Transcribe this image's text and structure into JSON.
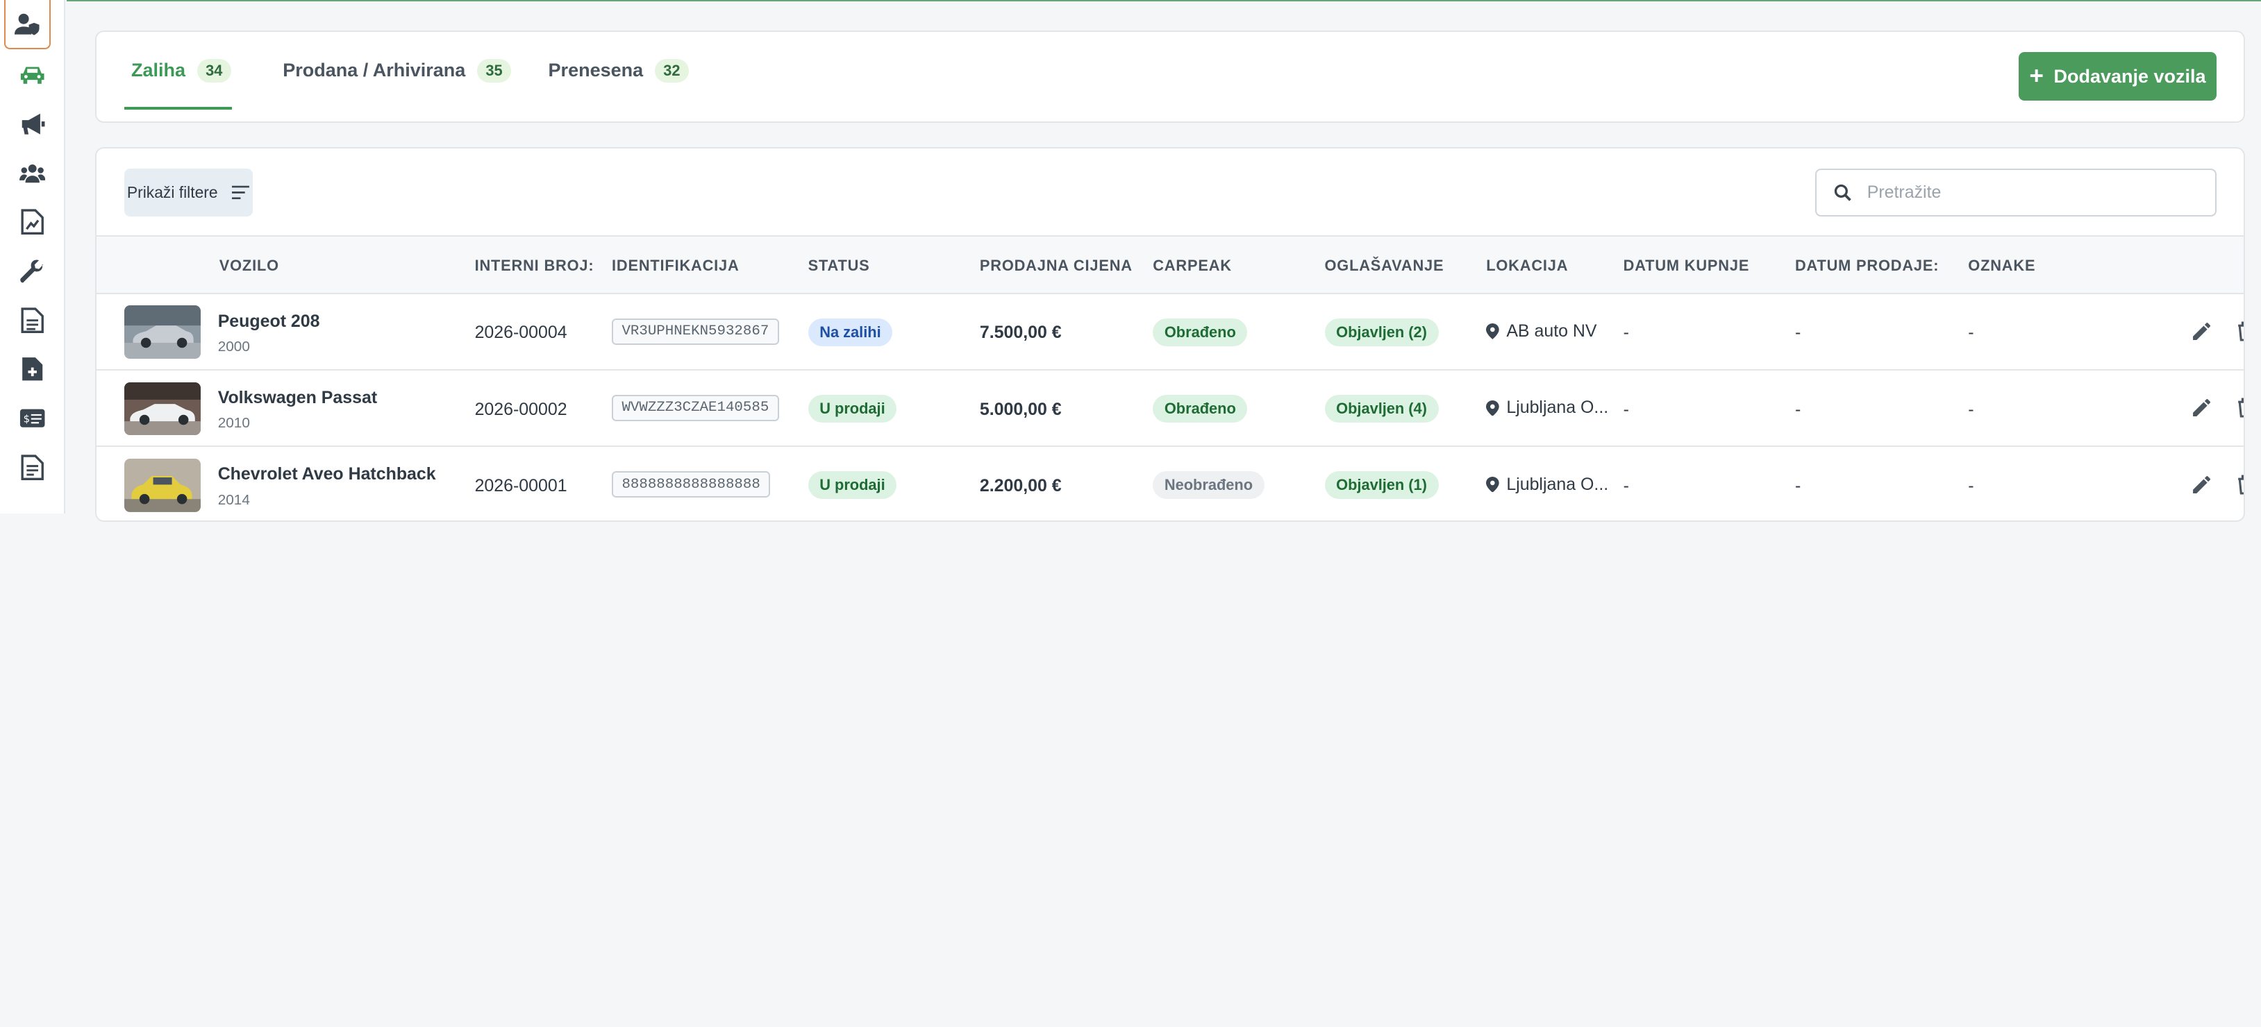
{
  "colors": {
    "accent": "#3d9956",
    "button": "#4b9b5c",
    "status_blue_bg": "#dbe9ff",
    "status_blue_text": "#1f4fa3",
    "status_green_bg": "#dcf3e3",
    "status_green_text": "#1e6b34",
    "status_grey_bg": "#eef0f2",
    "status_grey_text": "#6b7680"
  },
  "sidebar": {
    "items": [
      {
        "icon": "user-shield-icon"
      },
      {
        "icon": "car-icon"
      },
      {
        "icon": "megaphone-icon"
      },
      {
        "icon": "users-icon"
      },
      {
        "icon": "file-chart-icon"
      },
      {
        "icon": "wrench-icon"
      },
      {
        "icon": "document-icon"
      },
      {
        "icon": "file-plus-icon"
      },
      {
        "icon": "money-card-icon"
      },
      {
        "icon": "clipboard-icon"
      }
    ]
  },
  "tabs": [
    {
      "label": "Zaliha",
      "count": "34"
    },
    {
      "label": "Prodana / Arhivirana",
      "count": "35"
    },
    {
      "label": "Prenesena",
      "count": "32"
    }
  ],
  "add_button": {
    "label": "Dodavanje vozila"
  },
  "filter_button": {
    "label": "Prikaži filtere"
  },
  "search": {
    "placeholder": "Pretražite",
    "value": ""
  },
  "columns": [
    "VOZILO",
    "INTERNI BROJ:",
    "IDENTIFIKACIJA",
    "STATUS",
    "PRODAJNA CIJENA",
    "CARPEAK",
    "OGLAŠAVANJE",
    "LOKACIJA",
    "DATUM KUPNJE",
    "DATUM PRODAJE:",
    "OZNAKE"
  ],
  "rows": [
    {
      "name": "Peugeot 208",
      "year": "2000",
      "internal": "2026-00004",
      "vin": "VR3UPHNEKN5932867",
      "status": "Na zalihi",
      "status_kind": "blue",
      "price": "7.500,00 €",
      "carpeak": "Obrađeno",
      "carpeak_kind": "green",
      "ads": "Objavljen (2)",
      "location": "AB auto NV",
      "buy_date": "-",
      "sell_date": "-",
      "tags": "-"
    },
    {
      "name": "Volkswagen Passat",
      "year": "2010",
      "internal": "2026-00002",
      "vin": "WVWZZZ3CZAE140585",
      "status": "U prodaji",
      "status_kind": "green",
      "price": "5.000,00 €",
      "carpeak": "Obrađeno",
      "carpeak_kind": "green",
      "ads": "Objavljen (4)",
      "location": "Ljubljana O...",
      "buy_date": "-",
      "sell_date": "-",
      "tags": "-"
    },
    {
      "name": "Chevrolet Aveo Hatchback",
      "year": "2014",
      "internal": "2026-00001",
      "vin": "8888888888888888",
      "status": "U prodaji",
      "status_kind": "green",
      "price": "2.200,00 €",
      "carpeak": "Neobrađeno",
      "carpeak_kind": "grey",
      "ads": "Objavljen (1)",
      "location": "Ljubljana O...",
      "buy_date": "-",
      "sell_date": "-",
      "tags": "-"
    }
  ]
}
